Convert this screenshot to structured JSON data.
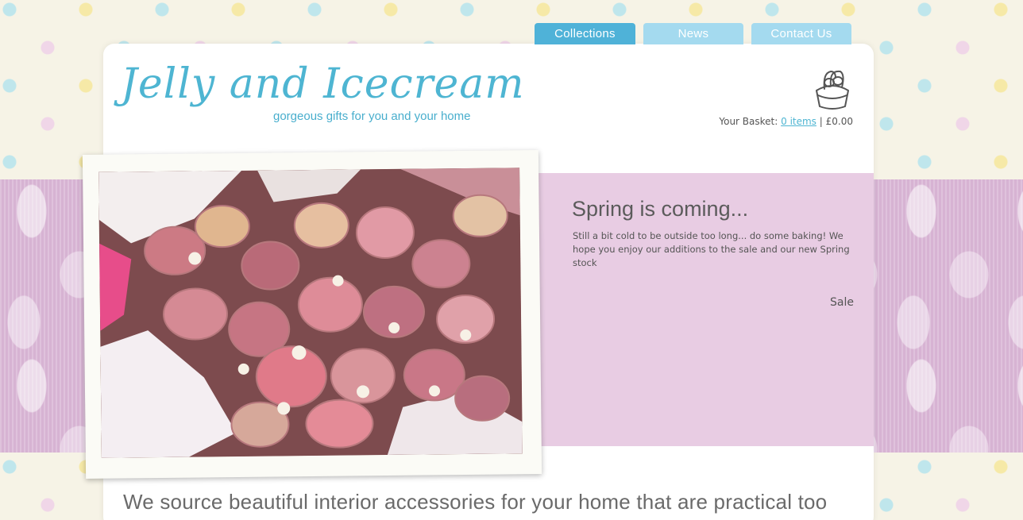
{
  "nav": {
    "tabs": [
      {
        "label": "Collections",
        "active": true
      },
      {
        "label": "News",
        "active": false
      },
      {
        "label": "Contact Us",
        "active": false
      }
    ]
  },
  "logo": {
    "title": "Jelly and Icecream",
    "tagline": "gorgeous gifts for you and your home"
  },
  "basket": {
    "label": "Your Basket:",
    "items_link": "0 items",
    "separator": "|",
    "total": "£0.00",
    "icon": "basket-icon"
  },
  "promo": {
    "title": "Spring is coming...",
    "text": "Still a bit cold to be outside too long... do some baking! We hope you enjoy our additions to the sale and our new Spring stock",
    "link": "Sale"
  },
  "intro": {
    "tagline": "We source beautiful interior accessories for your home that are practical too"
  },
  "colors": {
    "brand_blue": "#4eb5d2",
    "tab_active": "#4fb2d8",
    "tab_inactive": "#a4daef",
    "promo_bg": "#e8cce3",
    "damask": "#d7b3d3"
  }
}
